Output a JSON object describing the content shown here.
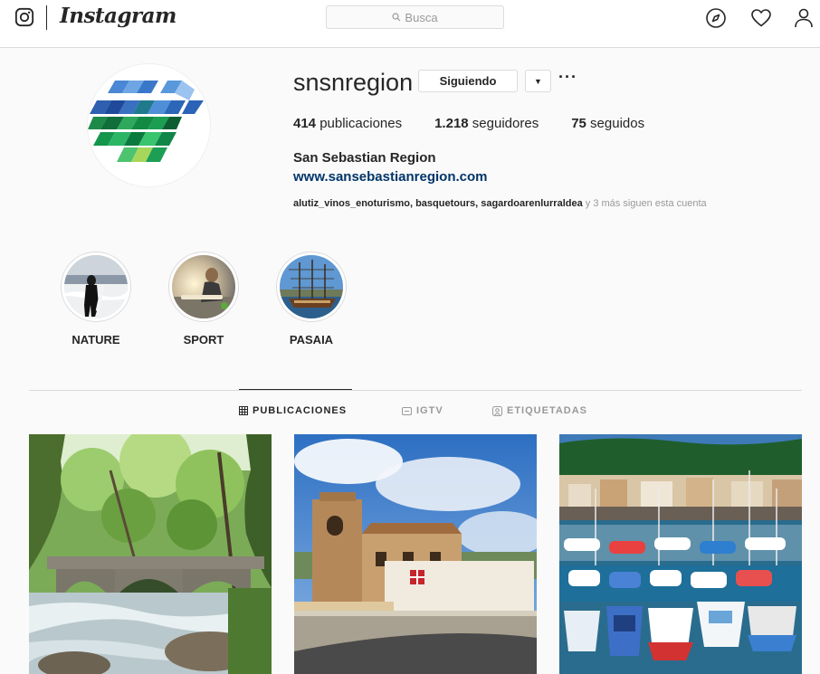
{
  "nav": {
    "wordmark": "Instagram",
    "search_placeholder": "Busca",
    "icons": [
      "instagram-glyph-icon",
      "compass-icon",
      "heart-icon",
      "user-icon"
    ]
  },
  "profile": {
    "username": "snsnregion",
    "follow_label": "Siguiendo",
    "dropdown_glyph": "▼",
    "more_glyph": "···",
    "stats": [
      {
        "count": "414",
        "label": " publicaciones"
      },
      {
        "count": "1.218",
        "label": " seguidores"
      },
      {
        "count": "75",
        "label": " seguidos"
      }
    ],
    "full_name": "San Sebastian Region",
    "website": "www.sansebastianregion.com",
    "followed_by_names": "alutiz_vinos_enoturismo, basquetours, sagardoarenlurraldea",
    "followed_by_suffix": " y 3 más siguen esta cuenta"
  },
  "highlights": [
    {
      "label": "NATURE"
    },
    {
      "label": "SPORT"
    },
    {
      "label": "PASAIA"
    }
  ],
  "tabs": [
    {
      "label": "PUBLICACIONES",
      "active": true
    },
    {
      "label": "IGTV",
      "active": false
    },
    {
      "label": "ETIQUETADAS",
      "active": false
    }
  ],
  "posts": [
    "forest-bridge-river-photo",
    "stone-church-building-photo",
    "harbor-boats-photo"
  ],
  "colors": {
    "link": "#003569",
    "border": "#dbdbdb",
    "muted": "#999999",
    "text": "#262626"
  }
}
